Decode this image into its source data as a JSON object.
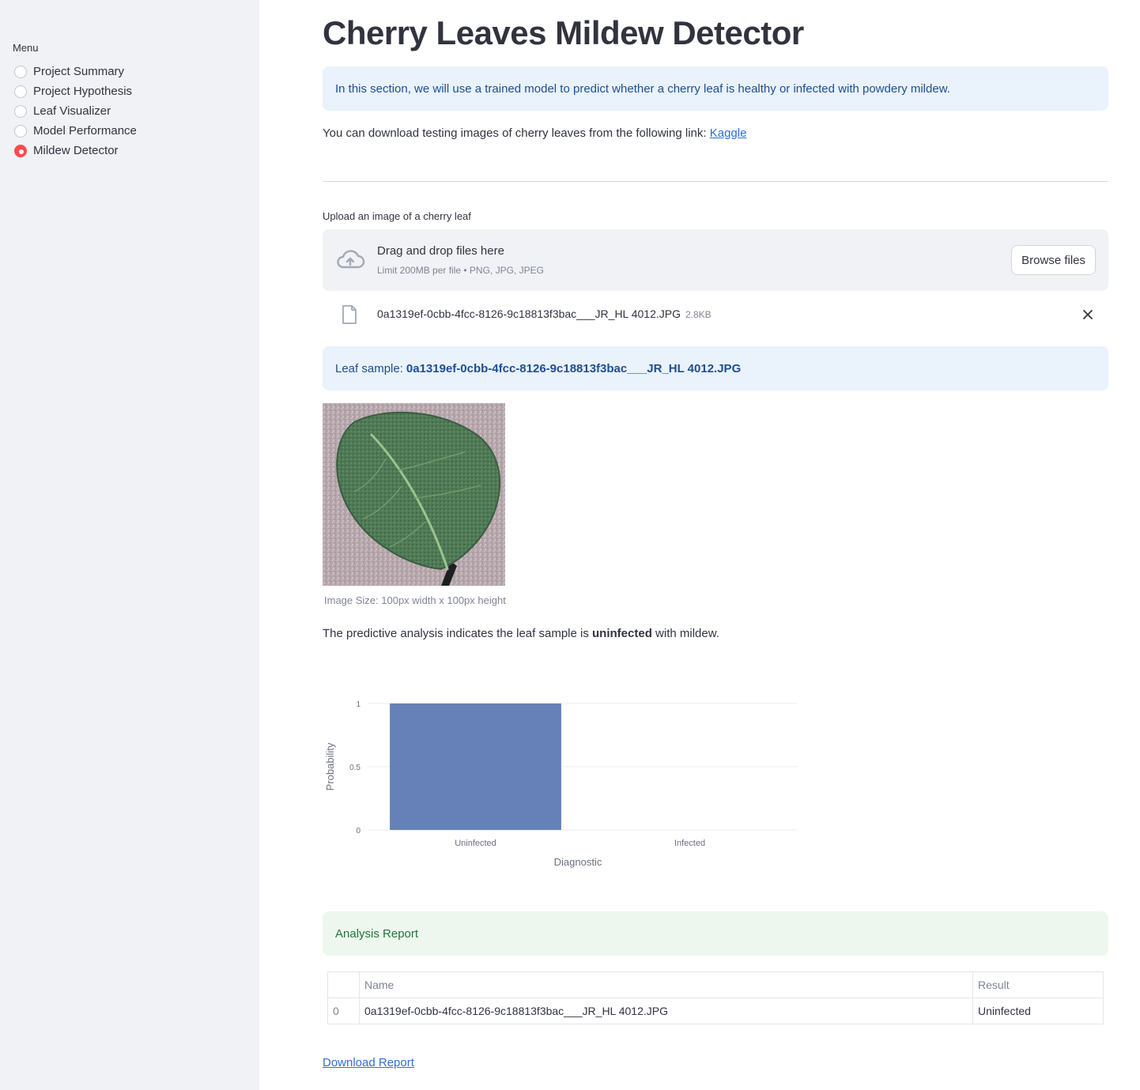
{
  "sidebar": {
    "menu_title": "Menu",
    "items": [
      {
        "label": "Project Summary",
        "selected": false
      },
      {
        "label": "Project Hypothesis",
        "selected": false
      },
      {
        "label": "Leaf Visualizer",
        "selected": false
      },
      {
        "label": "Model Performance",
        "selected": false
      },
      {
        "label": "Mildew Detector",
        "selected": true
      }
    ]
  },
  "main": {
    "title": "Cherry Leaves Mildew Detector",
    "info_text": "In this section, we will use a trained model to predict whether a cherry leaf is healthy or infected with powdery mildew.",
    "download_text": "You can download testing images of cherry leaves from the following link: ",
    "download_link": "Kaggle",
    "upload": {
      "label": "Upload an image of a cherry leaf",
      "drop_title": "Drag and drop files here",
      "drop_sub": "Limit 200MB per file • PNG, JPG, JPEG",
      "browse_label": "Browse files",
      "file_name": "0a1319ef-0cbb-4fcc-8126-9c18813f3bac___JR_HL 4012.JPG",
      "file_size": "2.8KB"
    },
    "sample": {
      "prefix": "Leaf sample: ",
      "name": "0a1319ef-0cbb-4fcc-8126-9c18813f3bac___JR_HL 4012.JPG"
    },
    "image_caption": "Image Size: 100px width x 100px height",
    "prediction": {
      "before": "The predictive analysis indicates the leaf sample is ",
      "result": "uninfected",
      "after": " with mildew."
    },
    "report_title": "Analysis Report",
    "report_table": {
      "headers": [
        "",
        "Name",
        "Result"
      ],
      "rows": [
        {
          "index": "0",
          "name": "0a1319ef-0cbb-4fcc-8126-9c18813f3bac___JR_HL 4012.JPG",
          "result": "Uninfected"
        }
      ]
    },
    "download_report": "Download Report"
  },
  "colors": {
    "accent": "#FF4B4B",
    "bar": "#6581B8",
    "info_bg": "#EAF2FB",
    "success_bg": "#EEF7EE"
  },
  "chart_data": {
    "type": "bar",
    "categories": [
      "Uninfected",
      "Infected"
    ],
    "values": [
      1,
      0
    ],
    "xlabel": "Diagnostic",
    "ylabel": "Probability",
    "ylim": [
      0,
      1
    ],
    "yticks": [
      "0",
      "0.5",
      "1"
    ],
    "grid": true
  }
}
